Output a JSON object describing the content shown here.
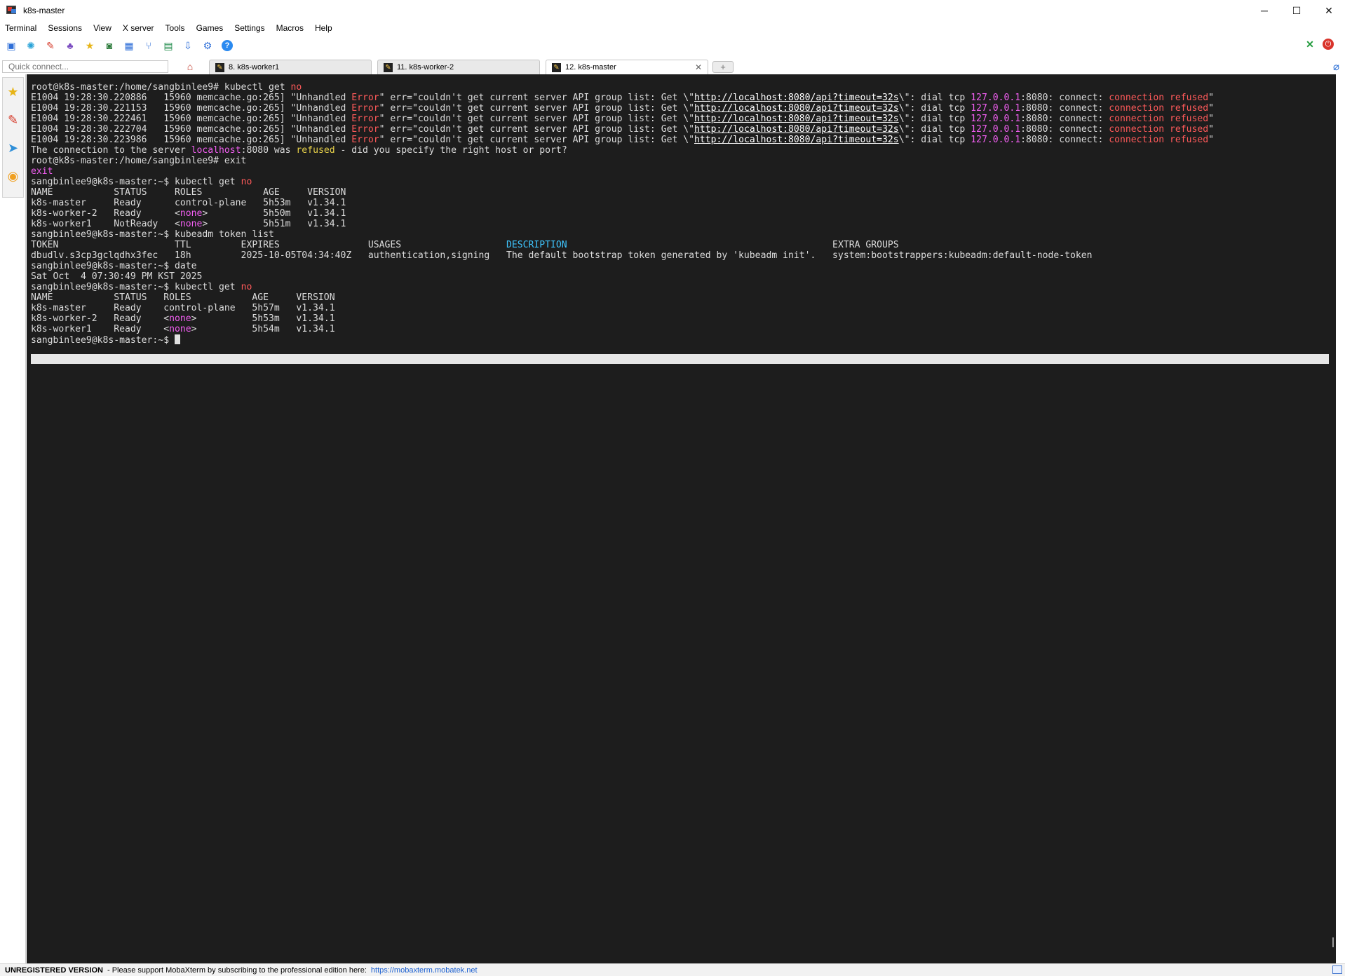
{
  "window": {
    "title": "k8s-master"
  },
  "window_controls": {
    "minimize": "─",
    "maximize": "☐",
    "close": "✕"
  },
  "menu": [
    "Terminal",
    "Sessions",
    "View",
    "X server",
    "Tools",
    "Games",
    "Settings",
    "Macros",
    "Help"
  ],
  "toolbar": {
    "icons": [
      "session-icon",
      "servers-icon",
      "tools-icon",
      "games-icon",
      "sessions-icon",
      "view-icon",
      "split-icon",
      "multiexec-icon",
      "tunneling-icon",
      "packages-icon",
      "settings-icon",
      "help-icon"
    ],
    "right_icons": [
      "xserver-icon",
      "exit-icon"
    ]
  },
  "quick_connect": {
    "placeholder": "Quick connect..."
  },
  "tabs": [
    {
      "label": "8. k8s-worker1"
    },
    {
      "label": "11. k8s-worker-2"
    },
    {
      "label": "12. k8s-master",
      "active": true
    }
  ],
  "terminal": {
    "lines": [
      [
        {
          "t": "root@k8s-master:/home/sangbinlee9# kubectl get "
        },
        {
          "t": "no",
          "c": "c-red"
        }
      ],
      [
        {
          "t": "E1004 19:28:30.220886   15960 memcache.go:265] \"Unhandled "
        },
        {
          "t": "Error",
          "c": "c-red"
        },
        {
          "t": "\" err=\"couldn't get current server API group list: Get \\\""
        },
        {
          "t": "http://localhost:8080/api?timeout=32s",
          "c": "c-url"
        },
        {
          "t": "\\\": dial tcp "
        },
        {
          "t": "127.0.0.1",
          "c": "c-mag"
        },
        {
          "t": ":8080: connect: "
        },
        {
          "t": "connection refused",
          "c": "c-red"
        },
        {
          "t": "\""
        }
      ],
      [
        {
          "t": "E1004 19:28:30.221153   15960 memcache.go:265] \"Unhandled "
        },
        {
          "t": "Error",
          "c": "c-red"
        },
        {
          "t": "\" err=\"couldn't get current server API group list: Get \\\""
        },
        {
          "t": "http://localhost:8080/api?timeout=32s",
          "c": "c-url"
        },
        {
          "t": "\\\": dial tcp "
        },
        {
          "t": "127.0.0.1",
          "c": "c-mag"
        },
        {
          "t": ":8080: connect: "
        },
        {
          "t": "connection refused",
          "c": "c-red"
        },
        {
          "t": "\""
        }
      ],
      [
        {
          "t": "E1004 19:28:30.222461   15960 memcache.go:265] \"Unhandled "
        },
        {
          "t": "Error",
          "c": "c-red"
        },
        {
          "t": "\" err=\"couldn't get current server API group list: Get \\\""
        },
        {
          "t": "http://localhost:8080/api?timeout=32s",
          "c": "c-url"
        },
        {
          "t": "\\\": dial tcp "
        },
        {
          "t": "127.0.0.1",
          "c": "c-mag"
        },
        {
          "t": ":8080: connect: "
        },
        {
          "t": "connection refused",
          "c": "c-red"
        },
        {
          "t": "\""
        }
      ],
      [
        {
          "t": "E1004 19:28:30.222704   15960 memcache.go:265] \"Unhandled "
        },
        {
          "t": "Error",
          "c": "c-red"
        },
        {
          "t": "\" err=\"couldn't get current server API group list: Get \\\""
        },
        {
          "t": "http://localhost:8080/api?timeout=32s",
          "c": "c-url"
        },
        {
          "t": "\\\": dial tcp "
        },
        {
          "t": "127.0.0.1",
          "c": "c-mag"
        },
        {
          "t": ":8080: connect: "
        },
        {
          "t": "connection refused",
          "c": "c-red"
        },
        {
          "t": "\""
        }
      ],
      [
        {
          "t": "E1004 19:28:30.223986   15960 memcache.go:265] \"Unhandled "
        },
        {
          "t": "Error",
          "c": "c-red"
        },
        {
          "t": "\" err=\"couldn't get current server API group list: Get \\\""
        },
        {
          "t": "http://localhost:8080/api?timeout=32s",
          "c": "c-url"
        },
        {
          "t": "\\\": dial tcp "
        },
        {
          "t": "127.0.0.1",
          "c": "c-mag"
        },
        {
          "t": ":8080: connect: "
        },
        {
          "t": "connection refused",
          "c": "c-red"
        },
        {
          "t": "\""
        }
      ],
      [
        {
          "t": "The connection to the server "
        },
        {
          "t": "localhost",
          "c": "c-mag"
        },
        {
          "t": ":8080 was "
        },
        {
          "t": "refused",
          "c": "c-yel"
        },
        {
          "t": " - did you specify the right host or port?"
        }
      ],
      [
        {
          "t": "root@k8s-master:/home/sangbinlee9# exit"
        }
      ],
      [
        {
          "t": "exit",
          "c": "c-mag"
        }
      ],
      [
        {
          "t": "sangbinlee9@k8s-master:~$ kubectl get "
        },
        {
          "t": "no",
          "c": "c-red"
        }
      ],
      [
        {
          "t": "NAME           STATUS     ROLES           AGE     VERSION"
        }
      ],
      [
        {
          "t": "k8s-master     Ready      control-plane   5h53m   v1.34.1"
        }
      ],
      [
        {
          "t": "k8s-worker-2   Ready      <"
        },
        {
          "t": "none",
          "c": "c-mag"
        },
        {
          "t": ">          5h50m   v1.34.1"
        }
      ],
      [
        {
          "t": "k8s-worker1    NotReady   <"
        },
        {
          "t": "none",
          "c": "c-mag"
        },
        {
          "t": ">          5h51m   v1.34.1"
        }
      ],
      [
        {
          "t": "sangbinlee9@k8s-master:~$ kubeadm token list"
        }
      ],
      [
        {
          "t": "TOKEN                     TTL         EXPIRES                USAGES                   "
        },
        {
          "t": "DESCRIPTION",
          "c": "c-cyan"
        },
        {
          "t": "                                                EXTRA GROUPS"
        }
      ],
      [
        {
          "t": "dbudlv.s3cp3gclqdhx3fec   18h         2025-10-05T04:34:40Z   authentication,signing   The default bootstrap token generated by 'kubeadm init'.   system:bootstrappers:kubeadm:default-node-token"
        }
      ],
      [
        {
          "t": "sangbinlee9@k8s-master:~$ date"
        }
      ],
      [
        {
          "t": "Sat Oct  4 07:30:49 PM KST 2025"
        }
      ],
      [
        {
          "t": "sangbinlee9@k8s-master:~$ kubectl get "
        },
        {
          "t": "no",
          "c": "c-red"
        }
      ],
      [
        {
          "t": "NAME           STATUS   ROLES           AGE     VERSION"
        }
      ],
      [
        {
          "t": "k8s-master     Ready    control-plane   5h57m   v1.34.1"
        }
      ],
      [
        {
          "t": "k8s-worker-2   Ready    <"
        },
        {
          "t": "none",
          "c": "c-mag"
        },
        {
          "t": ">          5h53m   v1.34.1"
        }
      ],
      [
        {
          "t": "k8s-worker1    Ready    <"
        },
        {
          "t": "none",
          "c": "c-mag"
        },
        {
          "t": ">          5h54m   v1.34.1"
        }
      ],
      [
        {
          "t": "sangbinlee9@k8s-master:~$ "
        }
      ]
    ]
  },
  "status": {
    "unregistered": "UNREGISTERED VERSION",
    "message": " -  Please support MobaXterm by subscribing to the professional edition here:",
    "link": "https://mobaxterm.mobatek.net"
  },
  "colors": {
    "terminal_bg": "#1d1d1d",
    "terminal_fg": "#dcdcdc",
    "error_red": "#ff5a5a",
    "magenta": "#f25ff2"
  }
}
